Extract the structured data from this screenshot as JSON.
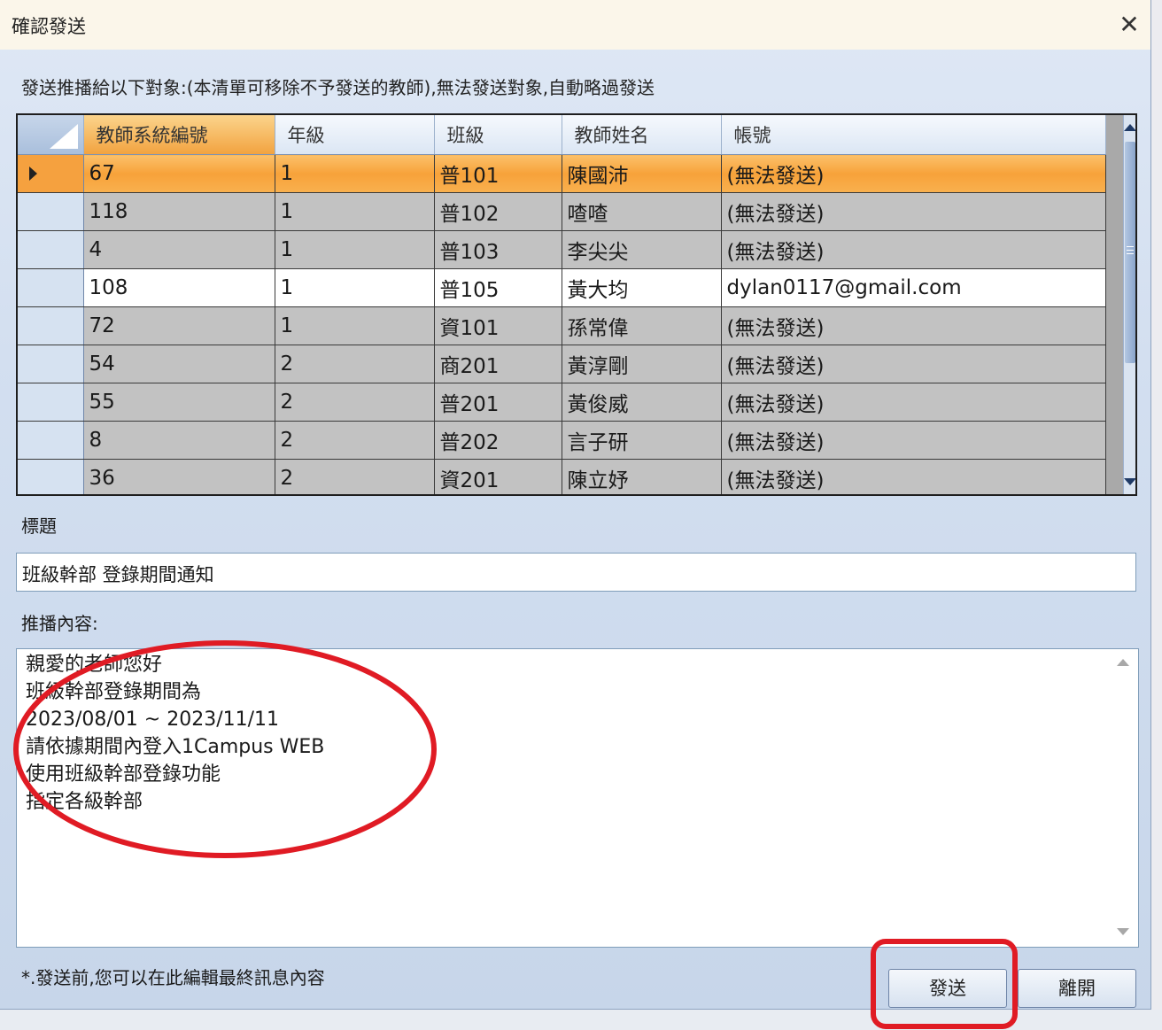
{
  "window": {
    "title": "確認發送",
    "close_symbol": "✕"
  },
  "description": "發送推播給以下對象:(本清單可移除不予發送的教師),無法發送對象,自動略過發送",
  "grid": {
    "columns": [
      "教師系統編號",
      "年級",
      "班級",
      "教師姓名",
      "帳號"
    ],
    "sorted_column": "教師系統編號",
    "rows": [
      [
        "67",
        "1",
        "普101",
        "陳國沛",
        "(無法發送)"
      ],
      [
        "118",
        "1",
        "普102",
        "喳喳",
        "(無法發送)"
      ],
      [
        "4",
        "1",
        "普103",
        "李尖尖",
        "(無法發送)"
      ],
      [
        "108",
        "1",
        "普105",
        "黃大均",
        "dylan0117@gmail.com"
      ],
      [
        "72",
        "1",
        "資101",
        "孫常偉",
        "(無法發送)"
      ],
      [
        "54",
        "2",
        "商201",
        "黃淳剛",
        "(無法發送)"
      ],
      [
        "55",
        "2",
        "普201",
        "黃俊威",
        "(無法發送)"
      ],
      [
        "8",
        "2",
        "普202",
        "言子研",
        "(無法發送)"
      ],
      [
        "36",
        "2",
        "資201",
        "陳立妤",
        "(無法發送)"
      ]
    ]
  },
  "title_label": "標題",
  "title_value": "班級幹部 登錄期間通知",
  "content_label": "推播內容:",
  "content_lines": [
    "親愛的老師您好",
    "班級幹部登錄期間為",
    "2023/08/01 ~ 2023/11/11",
    "請依據期間內登入1Campus WEB",
    "使用班級幹部登錄功能",
    "指定各級幹部"
  ],
  "note": "*.發送前,您可以在此編輯最終訊息內容",
  "buttons": {
    "send": "發送",
    "leave": "離開"
  },
  "annotation_color": "#e01b24",
  "selected_row_color": "#f7a23a"
}
